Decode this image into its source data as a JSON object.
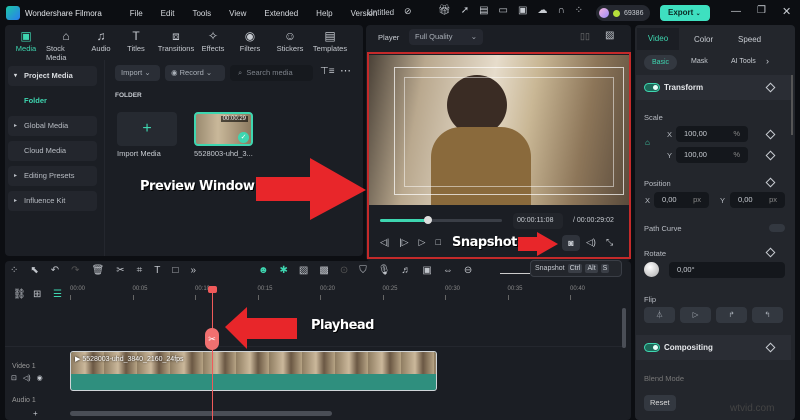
{
  "app": {
    "title": "Wondershare Filmora",
    "menu": [
      "File",
      "Edit",
      "Tools",
      "View",
      "Extended",
      "Help",
      "Version"
    ],
    "project": "Untitled",
    "credits": "69386",
    "export": "Export"
  },
  "media_toolbar": [
    {
      "label": "Media",
      "icon": "media-icon"
    },
    {
      "label": "Stock Media",
      "icon": "stock-icon"
    },
    {
      "label": "Audio",
      "icon": "music-icon"
    },
    {
      "label": "Titles",
      "icon": "text-icon"
    },
    {
      "label": "Transitions",
      "icon": "transition-icon"
    },
    {
      "label": "Effects",
      "icon": "effects-icon"
    },
    {
      "label": "Filters",
      "icon": "filter-icon"
    },
    {
      "label": "Stickers",
      "icon": "sticker-icon"
    },
    {
      "label": "Templates",
      "icon": "template-icon"
    }
  ],
  "sidebar": {
    "items": [
      "Project Media",
      "Folder",
      "Global Media",
      "Cloud Media",
      "Editing Presets",
      "Influence Kit"
    ]
  },
  "library": {
    "import": "Import",
    "record": "Record",
    "search_placeholder": "Search media",
    "folder_heading": "FOLDER",
    "import_media": "Import Media",
    "clip_name": "5528003-uhd_3...",
    "clip_duration": "00:00:29"
  },
  "player": {
    "label": "Player",
    "quality": "Full Quality",
    "current": "00:00:11:08",
    "total": "/ 00:00:29:02",
    "progress": 0.39,
    "tooltip": "Snapshot",
    "keys": [
      "Ctrl",
      "Alt",
      "S"
    ]
  },
  "inspector": {
    "tabs": [
      "Video",
      "Color",
      "Speed"
    ],
    "subtabs": [
      "Basic",
      "Mask",
      "AI Tools"
    ],
    "transform": "Transform",
    "scale": "Scale",
    "scale_x": "100,00",
    "scale_y": "100,00",
    "pct": "%",
    "position": "Position",
    "pos_x": "0,00",
    "pos_y": "0,00",
    "px": "px",
    "path_curve": "Path Curve",
    "rotate": "Rotate",
    "rotate_val": "0,00°",
    "flip": "Flip",
    "compositing": "Compositing",
    "blend_mode": "Blend Mode",
    "reset": "Reset",
    "x": "X",
    "y": "Y"
  },
  "timeline": {
    "ruler": [
      "00:00",
      "00:05",
      "00:10",
      "00:15",
      "00:20",
      "00:25",
      "00:30",
      "00:35",
      "00:40"
    ],
    "tracks": [
      "Video 1",
      "Audio 1"
    ],
    "clip_label": "5528003-uhd_3840_2160_24fps",
    "playhead_time": "00:00:11:08"
  },
  "annotations": {
    "preview": "Preview Window",
    "snapshot": "Snapshot",
    "playhead": "Playhead"
  },
  "watermark": "wtvid.com",
  "colors": {
    "accent": "#3ed6b0",
    "annotation": "#e8262a",
    "clip": "#2f8f7e"
  }
}
